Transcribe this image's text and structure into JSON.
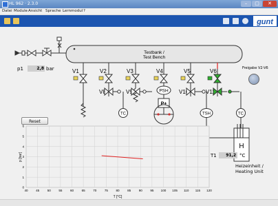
{
  "window": {
    "title": "HL 962 · 2.3.0",
    "controls": {
      "minimize": "–",
      "maximize": "▢",
      "close": "✕"
    }
  },
  "menu": [
    "Datei",
    "Module",
    "Ansicht",
    "Sprache",
    "Lernmodul",
    "?"
  ],
  "toolbar": {
    "left_icons": [
      "folder-icon",
      "chart-icon"
    ],
    "right_icons": [
      "printer-icon",
      "save-icon",
      "info-icon"
    ],
    "logo": "gunt"
  },
  "bench": {
    "line1": "Testbank /",
    "line2": "Test Bench"
  },
  "pressure": {
    "label": "p1",
    "value": "2,8",
    "unit": "bar"
  },
  "valves": [
    "V1",
    "V2",
    "V3",
    "V4",
    "V5",
    "V6",
    "V8",
    "V9",
    "V10",
    "V11"
  ],
  "instruments": {
    "psh": "PSH",
    "p_plus": "P+",
    "tsh": "TSH",
    "tc1": "TC",
    "tc2": "TC",
    "heater_letter": "H"
  },
  "release": {
    "label": "Freigabe V2-V6"
  },
  "reset_button": "Reset",
  "temperature": {
    "label": "T1",
    "value": "91,2",
    "unit": "°C"
  },
  "heating_unit": {
    "line1": "Heizeinheit /",
    "line2": "Heating Unit"
  },
  "colors": {
    "accent": "#1c55b0",
    "valve_active": "#2fae2f",
    "trend": "#e02020",
    "titlebar": "#5b86c2"
  },
  "chart_data": {
    "type": "line",
    "xlabel": "T [°C]",
    "ylabel": "p [bar]",
    "xlim": [
      40,
      120
    ],
    "ylim": [
      0,
      6
    ],
    "x_ticks": [
      "40",
      "45",
      "50",
      "55",
      "60",
      "65",
      "70",
      "75",
      "80",
      "85",
      "90",
      "95",
      "100",
      "105",
      "110",
      "115",
      "120"
    ],
    "y_ticks": [
      "0",
      "1",
      "2",
      "3",
      "4",
      "5",
      "6"
    ],
    "grid": true,
    "series": [
      {
        "x": [
          73,
          91
        ],
        "y": [
          3.1,
          2.8
        ]
      }
    ]
  }
}
